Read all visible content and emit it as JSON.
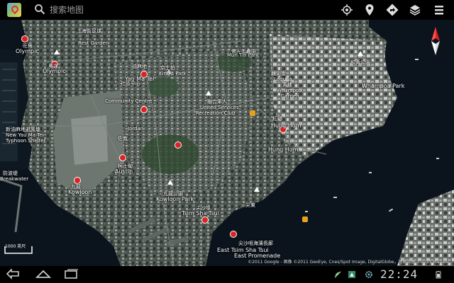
{
  "search": {
    "placeholder": "搜索地图"
  },
  "map": {
    "labels": [
      {
        "text": "旺角",
        "note": "top-left"
      },
      {
        "text": "Olympic"
      },
      {
        "text": "奧運"
      },
      {
        "text": "Olympic"
      },
      {
        "text": "上海街足球"
      },
      {
        "text": "Rest Garden"
      },
      {
        "text": "油麻地"
      },
      {
        "text": "Yau Ma Tei"
      },
      {
        "text": "京士柏"
      },
      {
        "text": "King's Park"
      },
      {
        "text": "社區中心"
      },
      {
        "text": "Community Centre"
      },
      {
        "text": "新油麻地避風塘"
      },
      {
        "text": "New Yau Ma Tei"
      },
      {
        "text": "Typhoon Shelter"
      },
      {
        "text": "防波堤"
      },
      {
        "text": "Breakwater"
      },
      {
        "text": "佐敦"
      },
      {
        "text": "Jordan"
      },
      {
        "text": "柯士甸"
      },
      {
        "text": "Austin"
      },
      {
        "text": "九龍"
      },
      {
        "text": "Kowloon"
      },
      {
        "text": "九龍公園"
      },
      {
        "text": "Kowloon Park"
      },
      {
        "text": "尖沙咀"
      },
      {
        "text": "Tsim Sha Tsui"
      },
      {
        "text": "尖東"
      },
      {
        "text": "East Tsim Sha Tsui"
      },
      {
        "text": "尖沙咀海濱長廊"
      },
      {
        "text": "East Promenade"
      },
      {
        "text": "佛光街公園"
      },
      {
        "text": "聯合軍人"
      },
      {
        "text": "United Services"
      },
      {
        "text": "Recreation Club"
      },
      {
        "text": "紅磡"
      },
      {
        "text": "Hung Hom"
      },
      {
        "text": "Hung Hom"
      },
      {
        "text": "蕪湖街"
      },
      {
        "text": "Laguna"
      },
      {
        "text": "黃埔"
      },
      {
        "text": "Whampoa"
      },
      {
        "text": "Garden"
      },
      {
        "text": "和黃公園"
      },
      {
        "text": "Whampoa Park"
      },
      {
        "text": "Mun Tin Park"
      }
    ],
    "scale_text": "1000 英尺",
    "copyright": "©2011 Google - 图像 ©2011 GeoEye, Cnes/Spot Image, DigitalGlobe，地图数据 ©2011 Mapabc"
  },
  "status": {
    "time": "22:24"
  },
  "icons": {
    "app": "maps-app-icon",
    "search": "search-icon",
    "my_location": "my-location-icon",
    "places": "places-icon",
    "directions": "directions-icon",
    "layers": "layers-icon",
    "menu": "menu-icon",
    "back": "back-icon",
    "home": "home-icon",
    "recents": "recent-apps-icon"
  }
}
